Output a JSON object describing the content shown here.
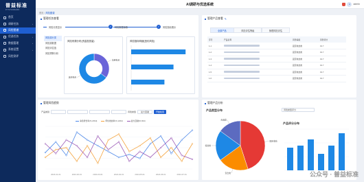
{
  "brand": {
    "name": "普益标准",
    "tagline": "PYSTANDARD"
  },
  "app_title": "AI调研与优选系统",
  "user": {
    "avatar": "A",
    "name": "admin"
  },
  "sidebar": {
    "items": [
      {
        "label": "首页",
        "active": false
      },
      {
        "label": "调研任务",
        "active": false,
        "arrow": "›"
      },
      {
        "label": "风险图谱",
        "active": true
      },
      {
        "label": "优选任务",
        "active": false,
        "arrow": "›"
      },
      {
        "label": "数据管理",
        "active": false,
        "arrow": "›"
      },
      {
        "label": "系统设置",
        "active": false,
        "arrow": "›"
      },
      {
        "label": "风险测评",
        "active": false
      }
    ]
  },
  "breadcrumb": {
    "home": "首页",
    "current": "风险图谱"
  },
  "panels": {
    "analysis": {
      "title": "管理任务查看",
      "steps": [
        {
          "label": "风险分类显示"
        },
        {
          "label": "风险数据读取"
        },
        {
          "label": "风险指标展示"
        }
      ],
      "submenu": [
        "风险源分类",
        "风险源数据",
        "风险评估值",
        "风险预警分析"
      ]
    },
    "products": {
      "title": "管理产品查看",
      "tabs": [
        "全部产品",
        "风险评估等级",
        "管理风险评估"
      ],
      "table": {
        "headers": [
          "序号",
          "产品名称",
          "风险等级",
          "风险评分"
        ],
        "rows": [
          {
            "no": "1-1",
            "level": "固定收益类",
            "score": "19.7"
          },
          {
            "no": "1-2",
            "level": "固定收益类",
            "score": "19.7"
          },
          {
            "no": "1-3",
            "level": "固定收益类",
            "score": "19.7"
          },
          {
            "no": "1-4",
            "level": "固定收益类",
            "score": "19.7"
          },
          {
            "no": "1-5",
            "level": "固定收益类",
            "score": "19.7"
          },
          {
            "no": "1-6",
            "level": "固定收益类",
            "score": "19.7"
          }
        ]
      }
    },
    "trend": {
      "title": "管理风险趋势",
      "filters": {
        "product_label": "产品类别",
        "date_label": "风险类型",
        "period": "最大回撤",
        "button": "开始检索"
      }
    },
    "distribution": {
      "title": "管理产品分析",
      "select": "风险类型评分"
    }
  },
  "chart_data": [
    {
      "type": "pie",
      "title": "风险来源分布(资金投放量)",
      "slices": [
        {
          "label": "债券投资",
          "value": 35,
          "color": "#6a64d8"
        },
        {
          "label": "其他投资",
          "value": 65,
          "color": "#1e88e5"
        }
      ],
      "donut": true
    },
    {
      "type": "bar",
      "title": "风险指标明细(违约风险)",
      "orientation": "horizontal",
      "categories": [
        "A",
        "B",
        "C"
      ],
      "values": [
        90,
        70,
        55
      ],
      "color": "#1e88e5"
    },
    {
      "type": "line",
      "x": [
        "2024-01-01",
        "2024-02-01",
        "2024-03-01",
        "2024-04-01",
        "2024-05-01",
        "2024-06-01",
        "2024-07-01"
      ],
      "series": [
        {
          "name": "净值增长率(%,200d)",
          "color": "#4a86e8",
          "values": [
            85,
            140,
            70,
            190,
            150,
            120,
            90,
            60,
            75,
            55,
            130,
            170,
            80,
            150,
            200
          ]
        },
        {
          "name": "年化收益率(%,120d)",
          "color": "#f4a23b",
          "values": [
            60,
            100,
            110,
            40,
            120,
            30,
            150,
            180,
            90,
            120,
            160,
            60,
            110,
            40,
            130
          ]
        },
        {
          "name": "最大回撤(%,60d)",
          "color": "#9b59b6",
          "values": [
            130,
            80,
            150,
            120,
            60,
            170,
            100,
            140,
            40,
            90,
            60,
            110,
            160,
            70,
            50
          ]
        }
      ],
      "ylim": [
        0,
        220
      ]
    },
    {
      "type": "pie",
      "title": "产品类型分布",
      "slices": [
        {
          "label": "固定收益",
          "value": 45,
          "color": "#e53935"
        },
        {
          "label": "混合类",
          "value": 20,
          "color": "#fb8c00"
        },
        {
          "label": "权益类",
          "value": 20,
          "color": "#1e88e5"
        },
        {
          "label": "商品类",
          "value": 15,
          "color": "#5c6bc0"
        }
      ]
    },
    {
      "type": "bar",
      "title": "产品评分分布",
      "categories": [
        "1",
        "2",
        "3",
        "4",
        "5",
        "6"
      ],
      "values": [
        55,
        60,
        75,
        40,
        60,
        90
      ],
      "color": "#1e88e5"
    }
  ],
  "watermark": "公众号 · 普益标准"
}
